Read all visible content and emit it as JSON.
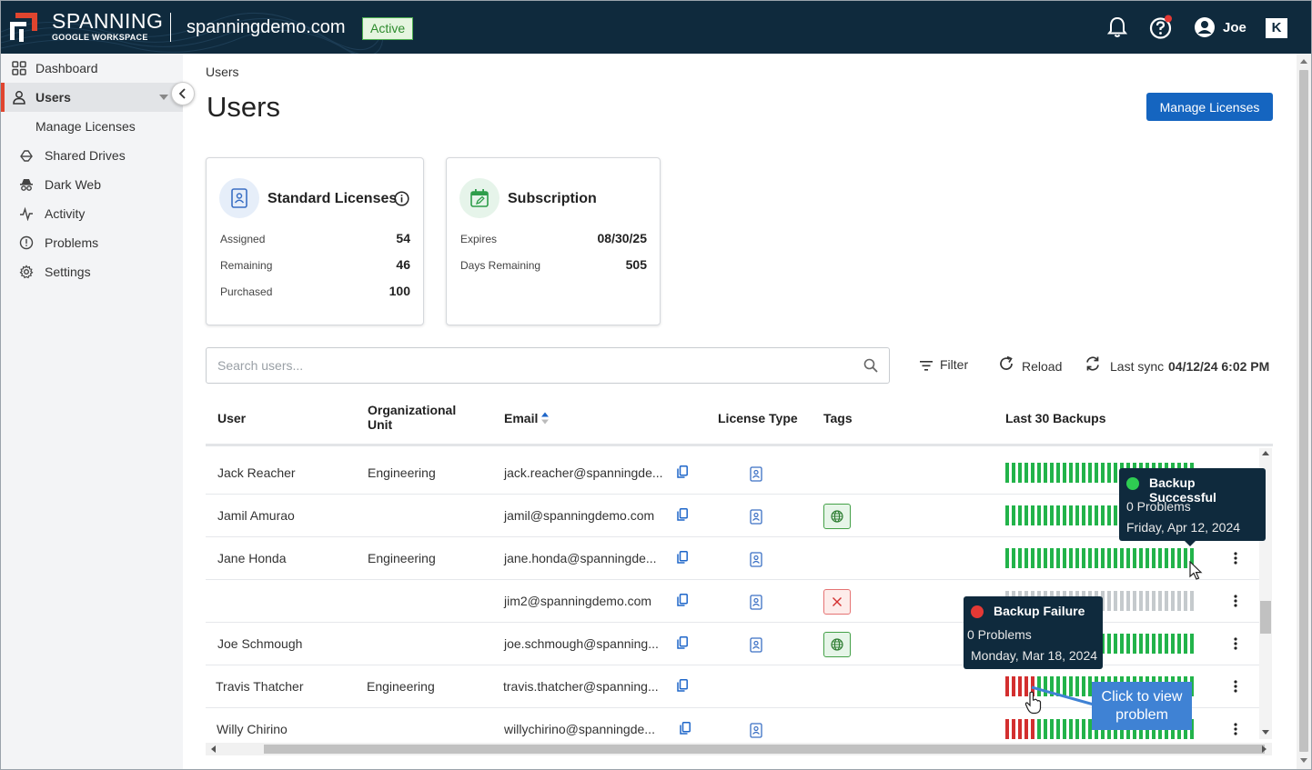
{
  "header": {
    "brand": "SPANNING",
    "brand_sub": "GOOGLE WORKSPACE",
    "domain": "spanningdemo.com",
    "status_badge": "Active",
    "user_name": "Joe",
    "k_logo": "K",
    "icons": [
      "bell-icon",
      "help-icon",
      "user-avatar-icon"
    ]
  },
  "sidebar": {
    "items": [
      {
        "label": "Dashboard",
        "icon": "dashboard-grid-icon"
      },
      {
        "label": "Users",
        "icon": "user-icon",
        "active": true
      },
      {
        "label": "Manage Licenses"
      },
      {
        "label": "Shared Drives",
        "icon": "shared-drive-icon"
      },
      {
        "label": "Dark Web",
        "icon": "spy-icon"
      },
      {
        "label": "Activity",
        "icon": "activity-pulse-icon"
      },
      {
        "label": "Problems",
        "icon": "alert-circle-icon"
      },
      {
        "label": "Settings",
        "icon": "gear-icon"
      }
    ]
  },
  "main": {
    "breadcrumb": "Users",
    "title": "Users",
    "manage_licenses_button": "Manage Licenses"
  },
  "cards": {
    "licenses": {
      "title": "Standard Licenses",
      "rows": [
        {
          "label": "Assigned",
          "value": "54"
        },
        {
          "label": "Remaining",
          "value": "46"
        },
        {
          "label": "Purchased",
          "value": "100"
        }
      ]
    },
    "subscription": {
      "title": "Subscription",
      "rows": [
        {
          "label": "Expires",
          "value": "08/30/25"
        },
        {
          "label": "Days Remaining",
          "value": "505"
        }
      ]
    }
  },
  "toolbar": {
    "search_placeholder": "Search users...",
    "filter": "Filter",
    "reload": "Reload",
    "last_sync_label": "Last sync",
    "last_sync_value": "04/12/24 6:02 PM"
  },
  "table": {
    "columns": [
      "User",
      "Organizational Unit",
      "Email",
      "License Type",
      "Tags",
      "Last 30 Backups"
    ],
    "rows": [
      {
        "user": "Jack Reacher",
        "ou": "Engineering",
        "email": "jack.reacher@spanningde...",
        "license": true,
        "tag": "",
        "backups": "30g"
      },
      {
        "user": "Jamil Amurao",
        "ou": "",
        "email": "jamil@spanningdemo.com",
        "license": true,
        "tag": "web",
        "backups": "30g"
      },
      {
        "user": "Jane Honda",
        "ou": "Engineering",
        "email": "jane.honda@spanningde...",
        "license": true,
        "tag": "",
        "backups": "30g"
      },
      {
        "user": "",
        "ou": "",
        "email": "jim2@spanningdemo.com",
        "license": true,
        "tag": "error",
        "backups": "30x"
      },
      {
        "user": "Joe Schmough",
        "ou": "",
        "email": "joe.schmough@spanning...",
        "license": true,
        "tag": "web",
        "backups": "30g"
      },
      {
        "user": "Travis Thatcher",
        "ou": "Engineering",
        "email": "travis.thatcher@spanning...",
        "license": false,
        "tag": "",
        "backups": "5r25g"
      },
      {
        "user": "Willy Chirino",
        "ou": "",
        "email": "willychirino@spanningde...",
        "license": true,
        "tag": "",
        "backups": "5r25g"
      }
    ]
  },
  "tooltips": {
    "success": {
      "title": "Backup Successful",
      "problems": "0 Problems",
      "date": "Friday, Apr 12, 2024",
      "color": "#2ecc52"
    },
    "failure": {
      "title": "Backup Failure",
      "problems": "0 Problems",
      "date": "Monday, Mar 18, 2024",
      "color": "#e53935"
    },
    "callout": "Click to view problem"
  },
  "colors": {
    "success": "#22b34a",
    "failure": "#d32f2f",
    "none": "#c5cacd",
    "header_bg": "#0f2a3d",
    "primary": "#1565c0"
  }
}
